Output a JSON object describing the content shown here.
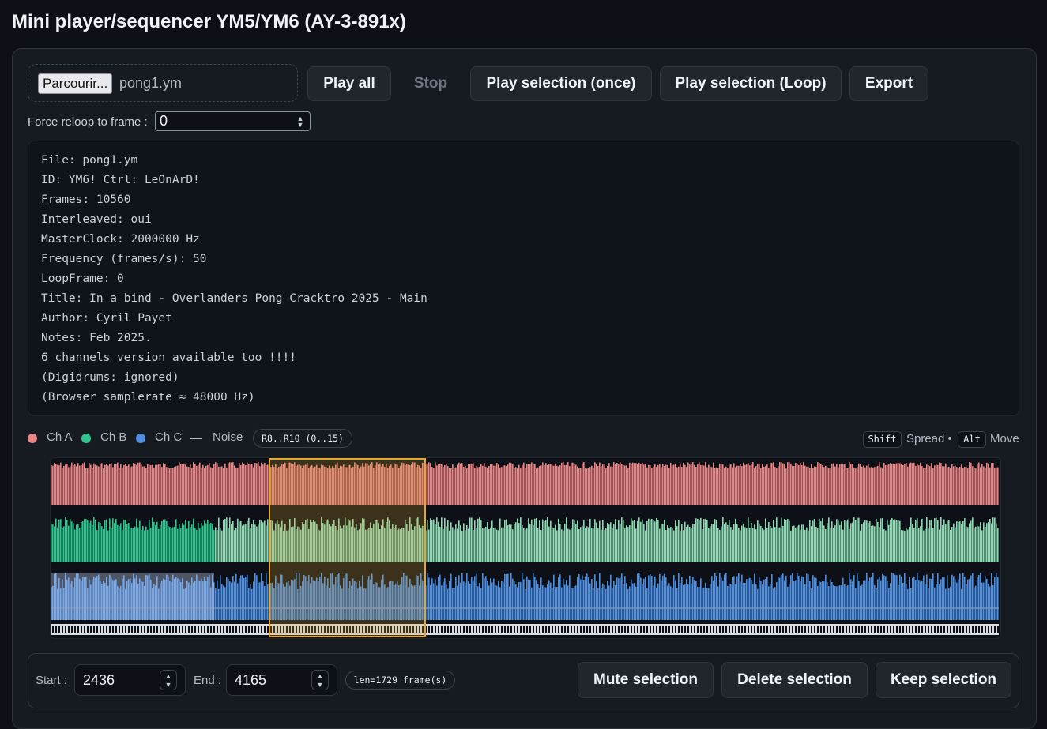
{
  "page": {
    "title": "Mini player/sequencer YM5/YM6 (AY-3-891x)"
  },
  "file_picker": {
    "browse_label": "Parcourir...",
    "file_name": "pong1.ym"
  },
  "toolbar": {
    "play_all": "Play all",
    "stop": "Stop",
    "play_sel_once": "Play selection (once)",
    "play_sel_loop": "Play selection (Loop)",
    "export": "Export"
  },
  "reloop": {
    "label": "Force reloop to frame :",
    "value": "0"
  },
  "info": {
    "lines": [
      "File: pong1.ym",
      "ID: YM6! Ctrl: LeOnArD!",
      "Frames: 10560",
      "Interleaved: oui",
      "MasterClock: 2000000 Hz",
      "Frequency (frames/s): 50",
      "LoopFrame: 0",
      "Title: In a bind - Overlanders Pong Cracktro 2025 - Main",
      "Author: Cyril Payet",
      "Notes: Feb 2025.",
      "6 channels version available too !!!!",
      "(Digidrums: ignored)",
      "(Browser samplerate ≈ 48000 Hz)"
    ]
  },
  "legend": {
    "ch_a": "Ch A",
    "ch_b": "Ch B",
    "ch_c": "Ch C",
    "noise": "Noise",
    "range": "R8..R10 (0..15)",
    "shift_key": "Shift",
    "spread": "Spread •",
    "alt_key": "Alt",
    "move": "Move",
    "colors": {
      "ch_a": "#e98686",
      "ch_b": "#2fc48d",
      "ch_c": "#4f8fe0",
      "selection": "#e3a72f"
    }
  },
  "selection": {
    "start_label": "Start :",
    "start_value": "2436",
    "end_label": "End :",
    "end_value": "4165",
    "length": "len=1729 frame(s)",
    "total_frames": 10560
  },
  "actions": {
    "mute": "Mute selection",
    "delete": "Delete selection",
    "keep": "Keep selection"
  }
}
